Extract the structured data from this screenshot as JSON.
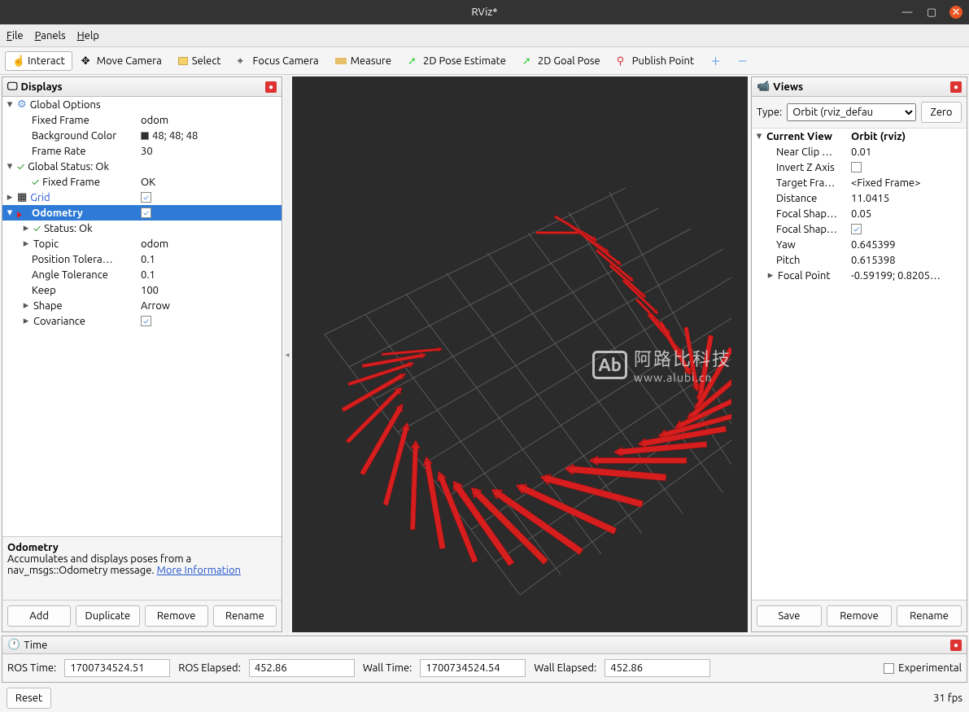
{
  "window": {
    "title": "RViz*"
  },
  "menu": {
    "file": "File",
    "panels": "Panels",
    "help": "Help"
  },
  "toolbar": {
    "interact": "Interact",
    "move_camera": "Move Camera",
    "select": "Select",
    "focus_camera": "Focus Camera",
    "measure": "Measure",
    "pose_estimate": "2D Pose Estimate",
    "goal_pose": "2D Goal Pose",
    "publish_point": "Publish Point"
  },
  "displays": {
    "title": "Displays",
    "global_options": {
      "label": "Global Options",
      "fixed_frame": {
        "k": "Fixed Frame",
        "v": "odom"
      },
      "background_color": {
        "k": "Background Color",
        "v": "48; 48; 48"
      },
      "frame_rate": {
        "k": "Frame Rate",
        "v": "30"
      }
    },
    "global_status": {
      "label": "Global Status: Ok",
      "fixed_frame": {
        "k": "Fixed Frame",
        "v": "OK"
      }
    },
    "grid": {
      "label": "Grid",
      "checked": true
    },
    "odometry": {
      "label": "Odometry",
      "checked": true,
      "status": "Status: Ok",
      "topic": {
        "k": "Topic",
        "v": "odom"
      },
      "position_tol": {
        "k": "Position Tolera…",
        "v": "0.1"
      },
      "angle_tol": {
        "k": "Angle Tolerance",
        "v": "0.1"
      },
      "keep": {
        "k": "Keep",
        "v": "100"
      },
      "shape": {
        "k": "Shape",
        "v": "Arrow"
      },
      "covariance": {
        "k": "Covariance",
        "checked": true
      }
    },
    "description": {
      "title": "Odometry",
      "text": "Accumulates and displays poses from a nav_msgs::Odometry message.",
      "link": "More Information"
    },
    "buttons": {
      "add": "Add",
      "duplicate": "Duplicate",
      "remove": "Remove",
      "rename": "Rename"
    }
  },
  "views": {
    "title": "Views",
    "type_label": "Type:",
    "type_value": "Orbit (rviz_defau",
    "zero": "Zero",
    "current_view": {
      "k": "Current View",
      "v": "Orbit (rviz)"
    },
    "props": {
      "near_clip": {
        "k": "Near Clip …",
        "v": "0.01"
      },
      "invert_z": {
        "k": "Invert Z Axis",
        "checked": false
      },
      "target_frame": {
        "k": "Target Fra…",
        "v": "<Fixed Frame>"
      },
      "distance": {
        "k": "Distance",
        "v": "11.0415"
      },
      "focal_shape_size": {
        "k": "Focal Shap…",
        "v": "0.05"
      },
      "focal_shape_chk": {
        "k": "Focal Shap…",
        "checked": true
      },
      "yaw": {
        "k": "Yaw",
        "v": "0.645399"
      },
      "pitch": {
        "k": "Pitch",
        "v": "0.615398"
      },
      "focal_point": {
        "k": "Focal Point",
        "v": "-0.59199; 0.8205…"
      }
    },
    "buttons": {
      "save": "Save",
      "remove": "Remove",
      "rename": "Rename"
    }
  },
  "time": {
    "title": "Time",
    "ros_time": {
      "k": "ROS Time:",
      "v": "1700734524.51"
    },
    "ros_elapsed": {
      "k": "ROS Elapsed:",
      "v": "452.86"
    },
    "wall_time": {
      "k": "Wall Time:",
      "v": "1700734524.54"
    },
    "wall_elapsed": {
      "k": "Wall Elapsed:",
      "v": "452.86"
    },
    "experimental": "Experimental"
  },
  "bottom": {
    "reset": "Reset",
    "fps": "31 fps"
  },
  "watermark": {
    "logo": "Ab",
    "text1": "阿路比科技",
    "text2": "www.alubi.cn"
  }
}
